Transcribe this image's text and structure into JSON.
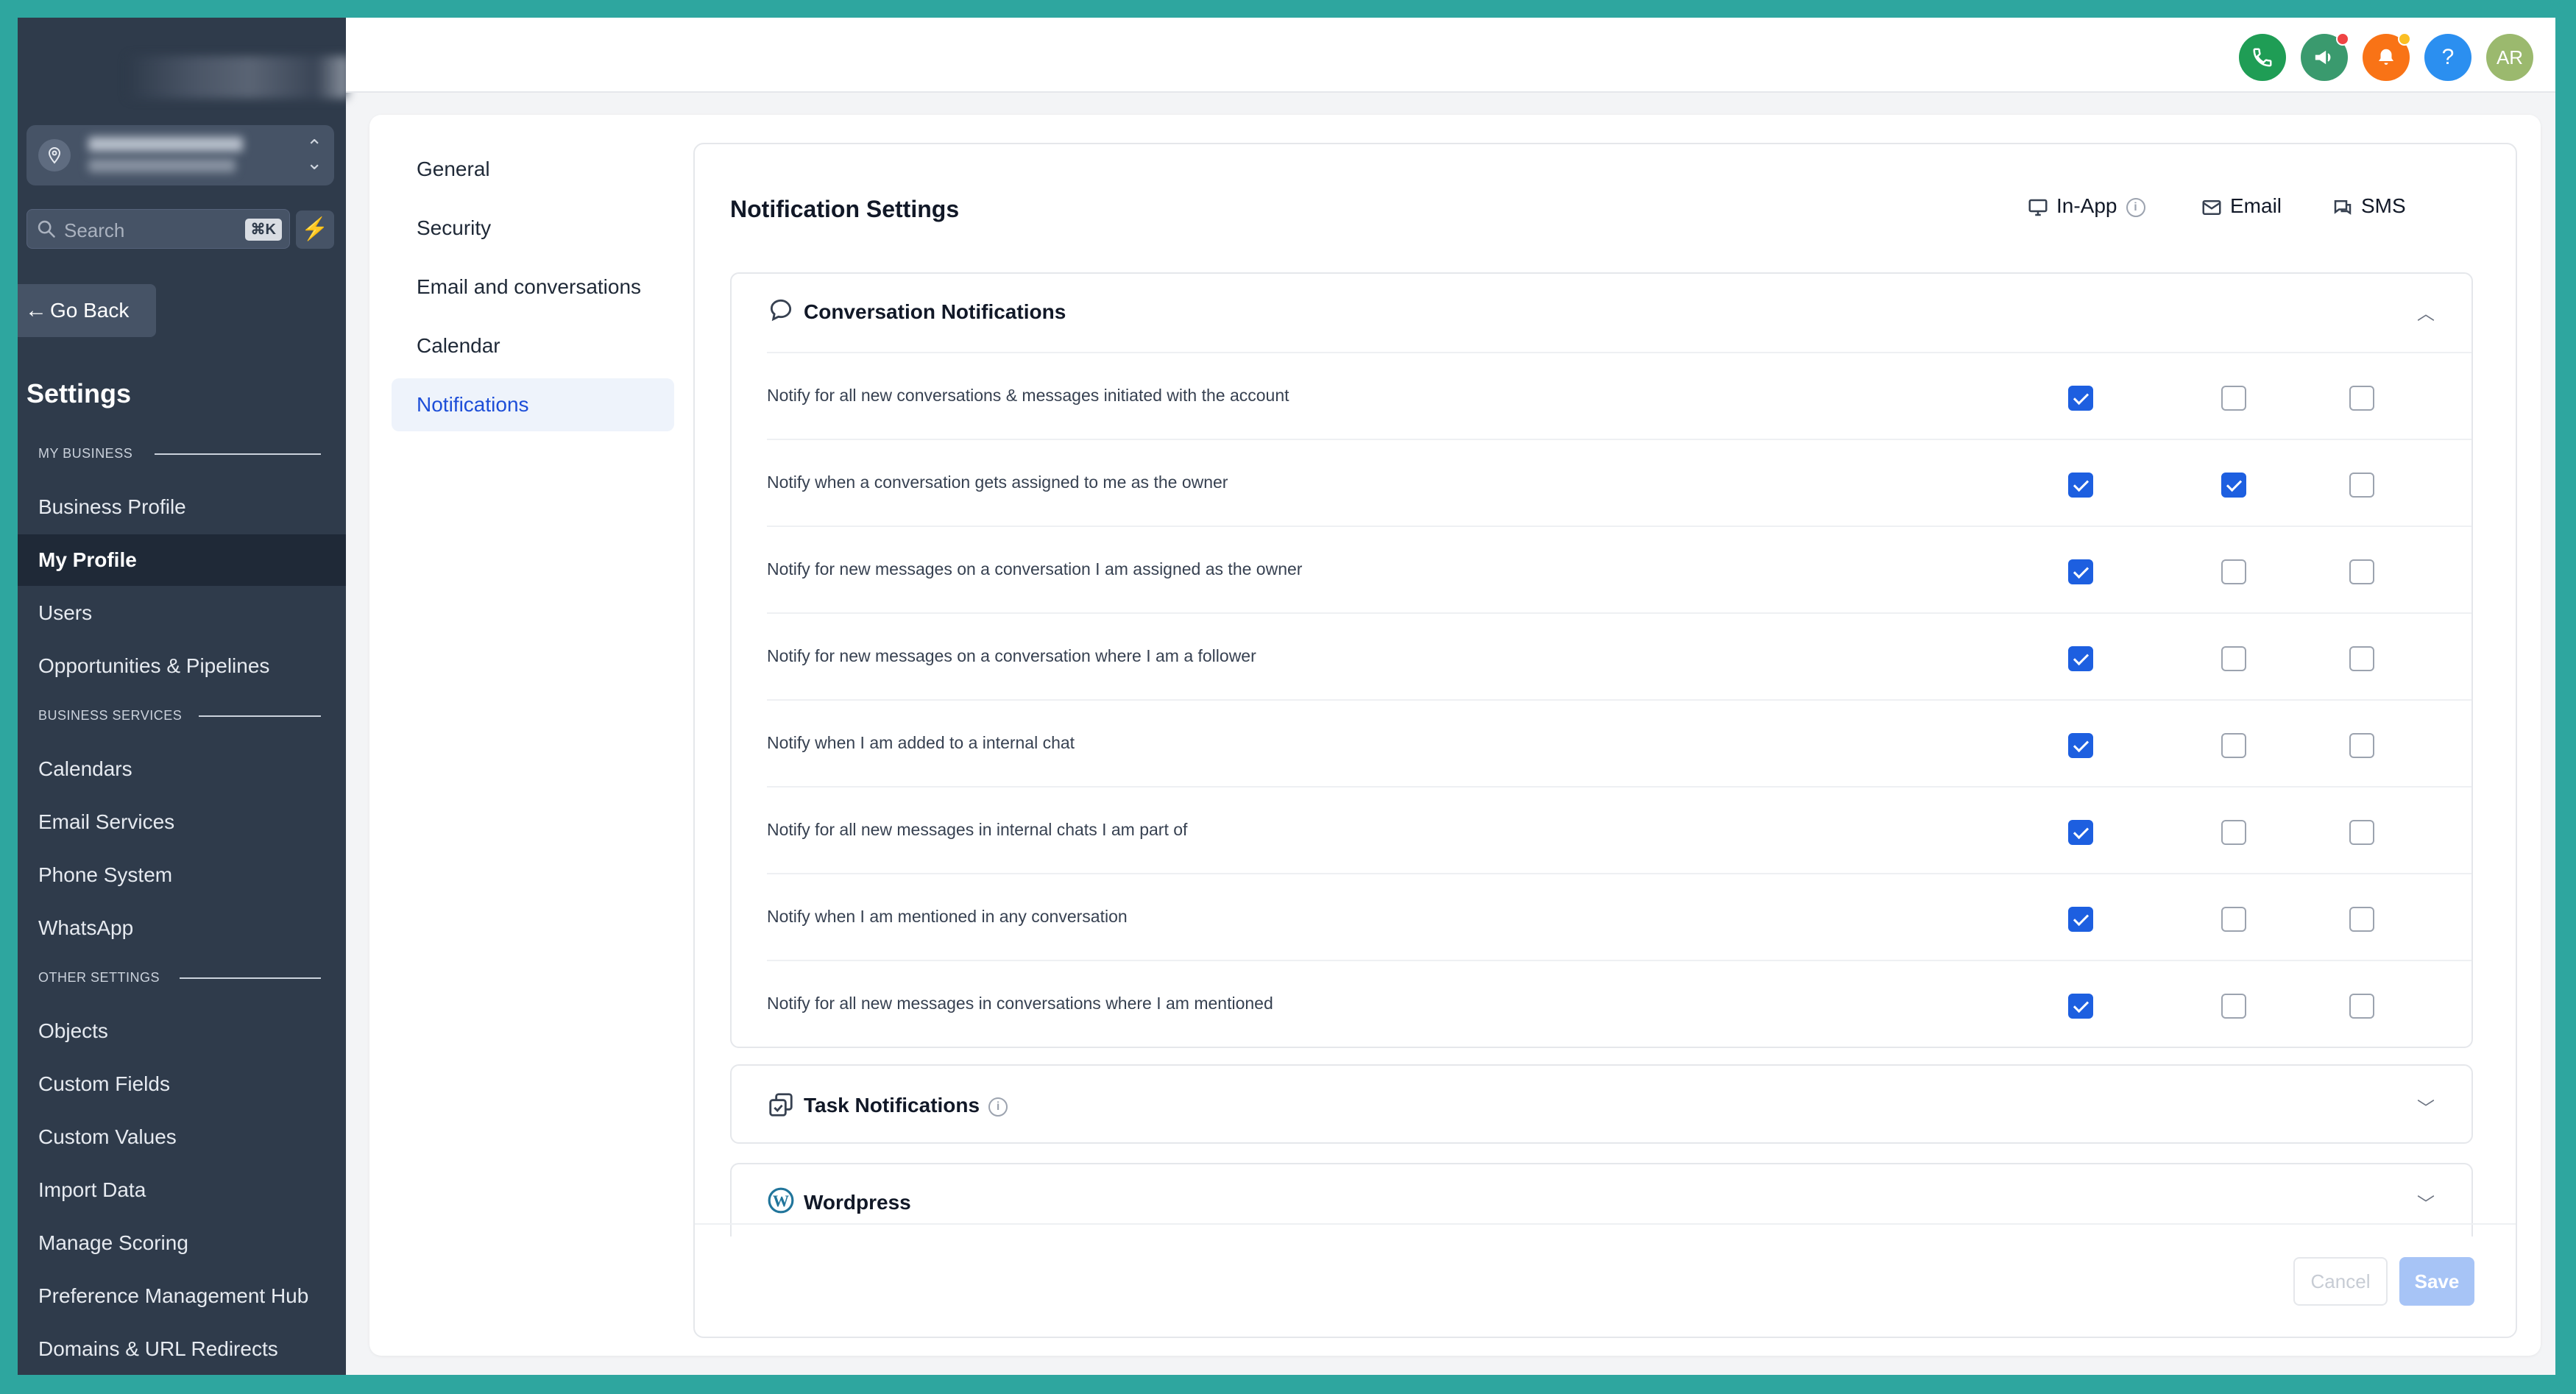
{
  "sidebar": {
    "search_placeholder": "Search",
    "search_shortcut": "⌘K",
    "go_back": "Go Back",
    "settings_title": "Settings",
    "sections": {
      "my_business": "MY BUSINESS",
      "business_services": "BUSINESS SERVICES",
      "other_settings": "OTHER SETTINGS"
    },
    "items": [
      {
        "label": "Business Profile"
      },
      {
        "label": "My Profile",
        "active": true
      },
      {
        "label": "Users"
      },
      {
        "label": "Opportunities & Pipelines"
      },
      {
        "label": "Calendars"
      },
      {
        "label": "Email Services"
      },
      {
        "label": "Phone System"
      },
      {
        "label": "WhatsApp"
      },
      {
        "label": "Objects"
      },
      {
        "label": "Custom Fields"
      },
      {
        "label": "Custom Values"
      },
      {
        "label": "Import Data"
      },
      {
        "label": "Manage Scoring"
      },
      {
        "label": "Preference Management Hub"
      },
      {
        "label": "Domains & URL Redirects"
      }
    ]
  },
  "topbar": {
    "avatar_initials": "AR",
    "help_label": "?",
    "colors": {
      "phone": "#1f9d55",
      "megaphone": "#3a9a6e",
      "bell": "#f97316",
      "help": "#2b8ff0",
      "avatar": "#9bb96e"
    }
  },
  "subnav": {
    "items": [
      {
        "label": "General"
      },
      {
        "label": "Security"
      },
      {
        "label": "Email and conversations"
      },
      {
        "label": "Calendar"
      },
      {
        "label": "Notifications",
        "active": true
      }
    ]
  },
  "panel": {
    "title": "Notification Settings",
    "channels": [
      {
        "label": "In-App",
        "icon": "monitor-icon"
      },
      {
        "label": "Email",
        "icon": "mail-icon"
      },
      {
        "label": "SMS",
        "icon": "chat-icon"
      }
    ],
    "conversation": {
      "title": "Conversation Notifications",
      "rows": [
        {
          "label": "Notify for all new conversations & messages initiated with the account",
          "in_app": true,
          "email": false,
          "sms": false
        },
        {
          "label": "Notify when a conversation gets assigned to me as the owner",
          "in_app": true,
          "email": true,
          "sms": false
        },
        {
          "label": "Notify for new messages on a conversation I am assigned as the owner",
          "in_app": true,
          "email": false,
          "sms": false
        },
        {
          "label": "Notify for new messages on a conversation where I am a follower",
          "in_app": true,
          "email": false,
          "sms": false
        },
        {
          "label": "Notify when I am added to a internal chat",
          "in_app": true,
          "email": false,
          "sms": false
        },
        {
          "label": "Notify for all new messages in internal chats I am part of",
          "in_app": true,
          "email": false,
          "sms": false
        },
        {
          "label": "Notify when I am mentioned in any conversation",
          "in_app": true,
          "email": false,
          "sms": false
        },
        {
          "label": "Notify for all new messages in conversations where I am mentioned",
          "in_app": true,
          "email": false,
          "sms": false
        }
      ]
    },
    "task_title": "Task Notifications",
    "wordpress_title": "Wordpress",
    "cancel_label": "Cancel",
    "save_label": "Save"
  }
}
